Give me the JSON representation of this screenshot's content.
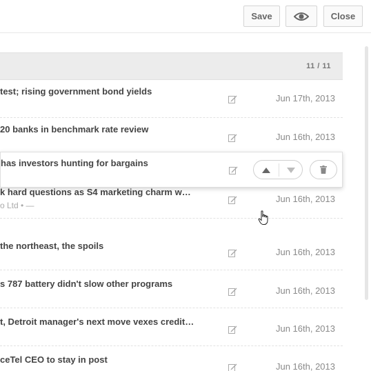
{
  "toolbar": {
    "save_label": "Save",
    "preview_icon": "eye-icon",
    "close_label": "Close"
  },
  "list": {
    "counter": "11 / 11",
    "rows": [
      {
        "title": "test; rising government bond yields",
        "date": "Jun 17th, 2013"
      },
      {
        "title": "20 banks in benchmark rate review",
        "date": "Jun 16th, 2013"
      },
      {
        "title": "has investors hunting for bargains",
        "actions": [
          "move-up-button",
          "move-down-button",
          "delete-button"
        ]
      },
      {
        "title": "k hard questions as S4 marketing charm w…",
        "subtitle": "o Ltd  •  —",
        "date": "Jun 16th, 2013"
      },
      {
        "title": "the northeast, the spoils",
        "date": "Jun 16th, 2013"
      },
      {
        "title": "s 787 battery didn't slow other programs",
        "date": "Jun 16th, 2013"
      },
      {
        "title": "t, Detroit manager's next move vexes credit…",
        "date": "Jun 16th, 2013"
      },
      {
        "title": "ceTel CEO to stay in post",
        "date": "Jun 16th, 2013"
      }
    ]
  },
  "colors": {
    "header_bg": "#ececec",
    "text": "#444444",
    "date": "#8a8a8a"
  }
}
